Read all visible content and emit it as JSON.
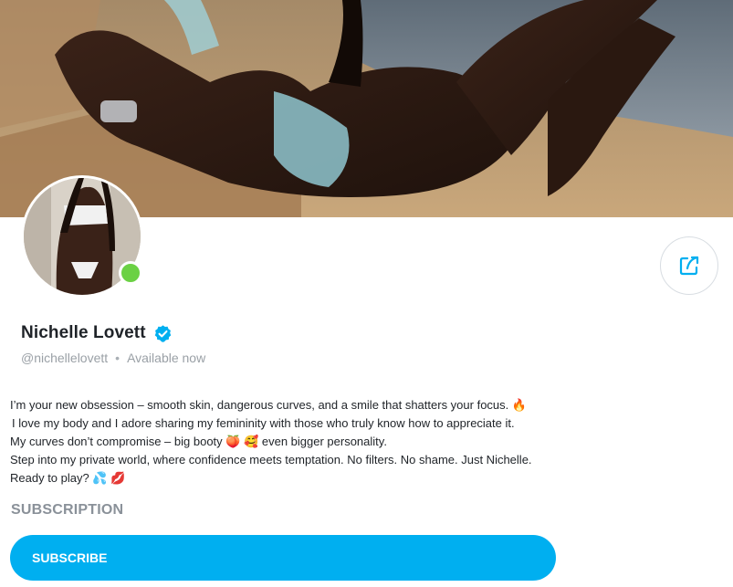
{
  "profile": {
    "name": "Nichelle Lovett",
    "handle": "@nichellelovett",
    "separator": "•",
    "status": "Available now",
    "verified": true,
    "online": true
  },
  "bio": {
    "lines": [
      "I’m your new obsession – smooth skin, dangerous curves, and a smile that shatters your focus. 🔥",
      "I love my body and I adore sharing my femininity with those who truly know how to appreciate it.",
      "My curves don’t compromise – big booty 🍑 🥰 even bigger personality.",
      "Step into my private world, where confidence meets temptation. No filters. No shame. Just Nichelle.",
      "Ready to play? 💦 💋"
    ]
  },
  "subscription": {
    "heading": "SUBSCRIPTION",
    "button_label": "SUBSCRIBE"
  },
  "icons": {
    "share": "share-icon",
    "verified": "verified-badge-icon"
  },
  "colors": {
    "accent": "#00aff0",
    "online": "#6bd144",
    "verified": "#00aff0",
    "text": "#1f2328",
    "muted": "#9aa0a6"
  }
}
